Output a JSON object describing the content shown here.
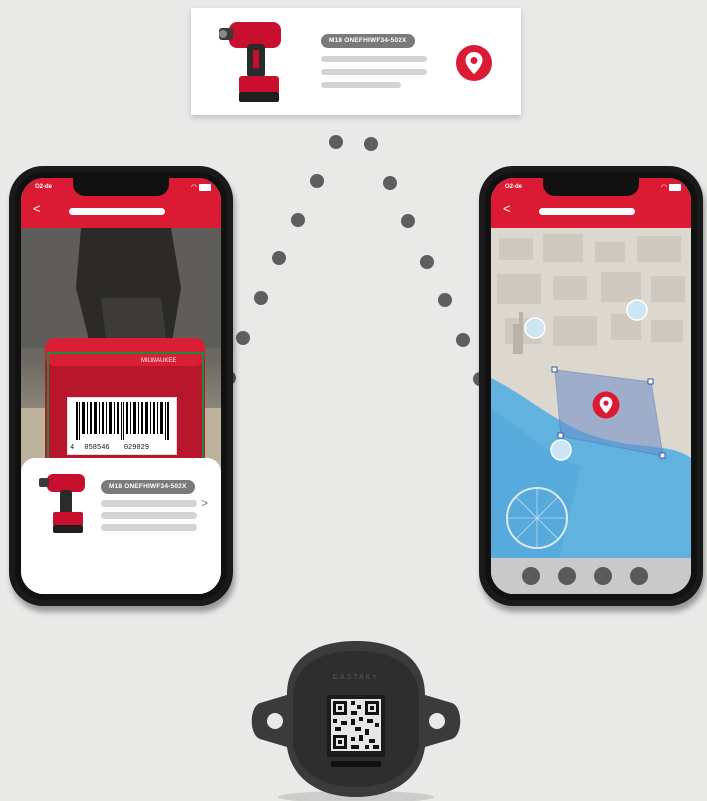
{
  "top_card": {
    "product_code": "M18 ONEFHIWF34-502X"
  },
  "left_phone": {
    "carrier": "O2-de",
    "back_label": "<",
    "barcode_left_digit": "4",
    "barcode_middle": "058546",
    "barcode_right": "029029",
    "result_card": {
      "product_code": "M18 ONEFHIWF34-502X",
      "chevron": ">"
    }
  },
  "right_phone": {
    "carrier": "O2-de",
    "back_label": "<"
  },
  "tag_device": {
    "brand": "CASTAKY"
  },
  "colors": {
    "brand_red": "#db1a34",
    "scan_green": "#1e8a3e",
    "dot_grey": "#5e5e5e"
  },
  "icons": [
    "location-pin-icon",
    "wifi-icon",
    "battery-icon",
    "back-icon",
    "chevron-right-icon",
    "qr-code-icon"
  ]
}
